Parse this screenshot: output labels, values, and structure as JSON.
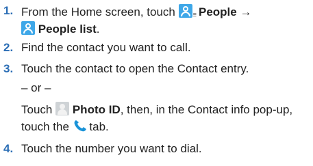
{
  "steps": [
    {
      "number": "1.",
      "line1_text": "From the Home screen, touch",
      "icon_small_label": "☰",
      "line1_bold": "People",
      "arrow": "→",
      "line2_bold": "People list",
      "line2_end": "."
    },
    {
      "number": "2.",
      "text": "Find the contact you want to call."
    },
    {
      "number": "3.",
      "text": "Touch the contact to open the Contact entry.",
      "or_text": "– or –",
      "line3_pre": "Touch",
      "line3_bold": "Photo ID",
      "line3_post": ", then, in the Contact info pop-up,",
      "line4_pre": "touch the",
      "line4_post": "tab."
    },
    {
      "number": "4.",
      "text": "Touch the number you want to dial."
    }
  ],
  "icons": {
    "people": "people-icon",
    "photo": "photo-id-icon",
    "phone": "phone-icon"
  },
  "colors": {
    "step_number": "#2a6db5",
    "icon_blue": "#3ea7e8",
    "icon_gray": "#cfd3d6"
  }
}
